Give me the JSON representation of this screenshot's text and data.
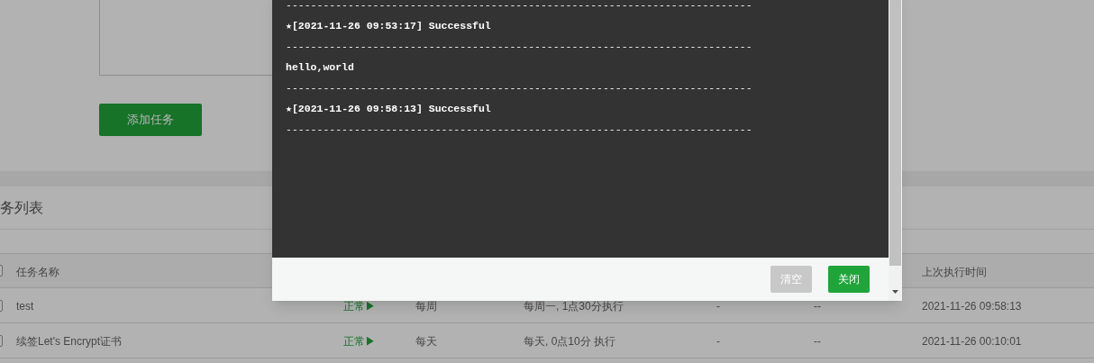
{
  "add_button": {
    "label": "添加任务"
  },
  "section_title": "务列表",
  "table": {
    "header": {
      "checked": false,
      "name": "任务名称",
      "last_run": "上次执行时间"
    },
    "rows": [
      {
        "checked": false,
        "name": "test",
        "status": "正常▶",
        "period": "每周",
        "detail": "每周一, 1点30分执行",
        "column_5": "-",
        "column_6": "--",
        "last_run": "2021-11-26 09:58:13"
      },
      {
        "checked": false,
        "name": "续签Let's Encrypt证书",
        "status": "正常▶",
        "period": "每天",
        "detail": "每天, 0点10分 执行",
        "column_5": "-",
        "column_6": "--",
        "last_run": "2021-11-26 00:10:01"
      }
    ]
  },
  "log_dialog": {
    "lines": [
      {
        "kind": "rule",
        "text": "---------------------------------------------------------------------------"
      },
      {
        "kind": "entry",
        "text": "★[2021-11-26 09:53:17] Successful"
      },
      {
        "kind": "rule",
        "text": "---------------------------------------------------------------------------"
      },
      {
        "kind": "entry",
        "text": "hello,world"
      },
      {
        "kind": "rule",
        "text": "---------------------------------------------------------------------------"
      },
      {
        "kind": "entry",
        "text": "★[2021-11-26 09:58:13] Successful"
      },
      {
        "kind": "rule",
        "text": "---------------------------------------------------------------------------"
      }
    ],
    "buttons": [
      {
        "label": "清空",
        "kind": "secondary"
      },
      {
        "label": "关闭",
        "kind": "primary"
      }
    ]
  }
}
